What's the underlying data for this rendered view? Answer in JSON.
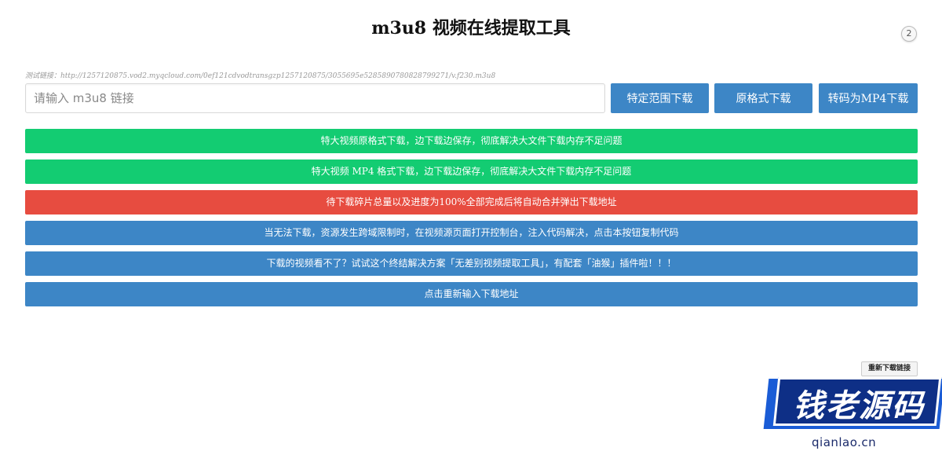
{
  "header": {
    "title": "m3u8 视频在线提取工具",
    "help_badge": "2"
  },
  "form": {
    "test_link": "测试链接：http://1257120875.vod2.myqcloud.com/0ef121cdvodtransgzp1257120875/3055695e5285890780828799271/v.f230.m3u8",
    "url_placeholder": "请输入 m3u8 链接",
    "url_value": "",
    "btn_range": "特定范围下载",
    "btn_original": "原格式下载",
    "btn_mp4": "转码为MP4下载"
  },
  "actions": [
    {
      "label": "特大视频原格式下载，边下载边保存，彻底解决大文件下载内存不足问题",
      "color": "#13cc72"
    },
    {
      "label": "特大视频 MP4 格式下载，边下载边保存，彻底解决大文件下载内存不足问题",
      "color": "#13cc72"
    },
    {
      "label": "待下载碎片总量以及进度为100%全部完成后将自动合并弹出下载地址",
      "color": "#e74c40"
    },
    {
      "label": "当无法下载，资源发生跨域限制时，在视频源页面打开控制台，注入代码解决，点击本按钮复制代码",
      "color": "#3d86c6"
    },
    {
      "label": "下载的视频看不了？试试这个终结解决方案「无差别视频提取工具」，有配套「油猴」插件啦！！！",
      "color": "#3d86c6"
    },
    {
      "label": "点击重新输入下载地址",
      "color": "#3d86c6"
    }
  ],
  "floating": {
    "redownload_label": "重新下载链接"
  },
  "watermark": {
    "text": "钱老源码",
    "domain": "qianlao.cn"
  }
}
